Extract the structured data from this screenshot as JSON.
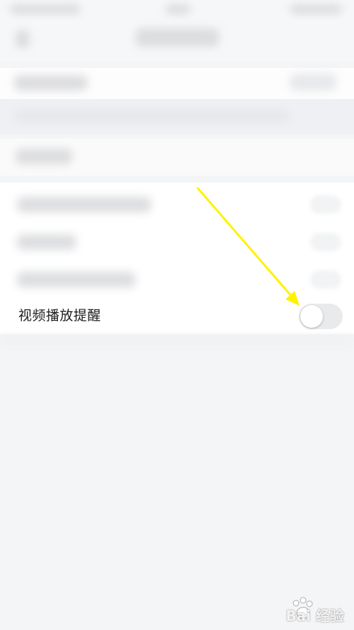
{
  "settings": {
    "video_reminder": {
      "label": "视频播放提醒",
      "enabled": false
    }
  },
  "watermark": {
    "text": "Bai 经验"
  },
  "colors": {
    "background": "#f4f5f7",
    "card": "#ffffff",
    "toggle_off_track": "#e9eaec",
    "annotation_arrow": "#fff200"
  },
  "icons": {
    "toggle": "toggle-switch-icon",
    "arrow": "annotation-arrow-icon",
    "watermark_paw": "paw-icon"
  }
}
